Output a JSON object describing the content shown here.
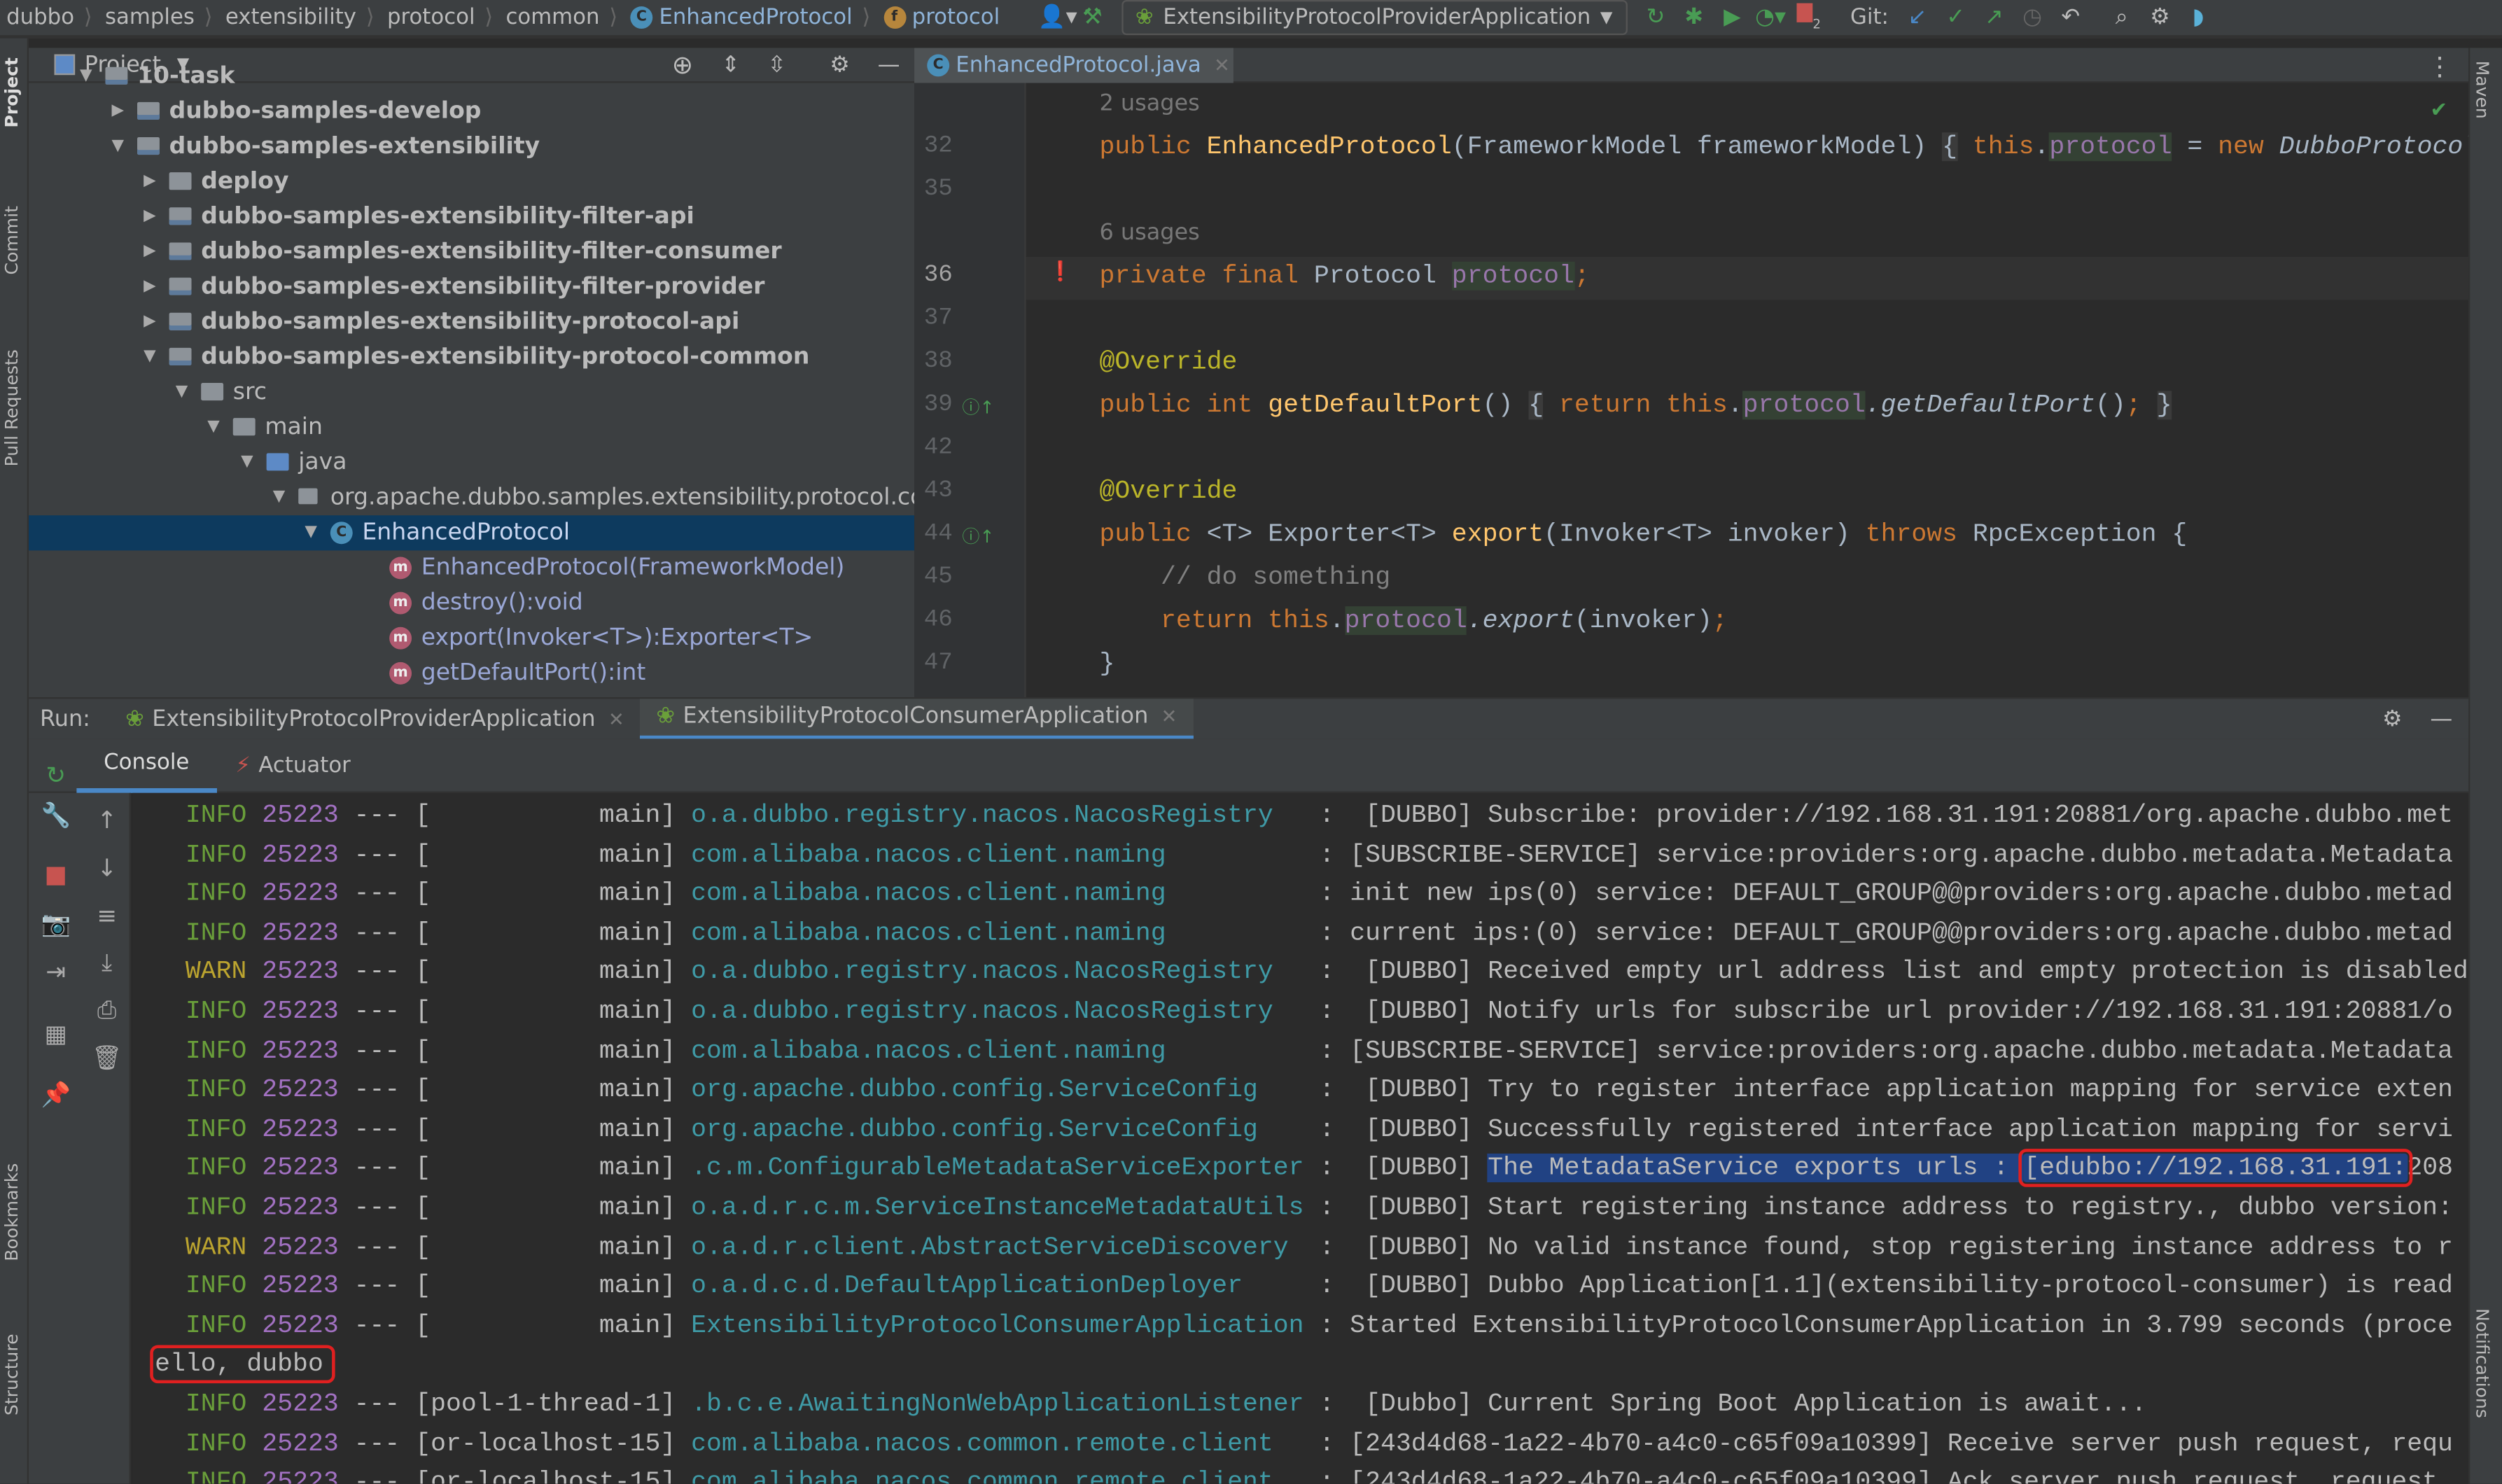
{
  "breadcrumb": [
    "dubbo",
    "samples",
    "extensibility",
    "protocol",
    "common",
    "EnhancedProtocol",
    "protocol"
  ],
  "toolbar": {
    "run_config": "ExtensibilityProtocolProviderApplication",
    "git_label": "Git:",
    "stop_badge": "2",
    "accent": "#499c54"
  },
  "left_strip": {
    "project": "Project",
    "commit": "Commit",
    "pull_requests": "Pull Requests",
    "bookmarks": "Bookmarks",
    "structure": "Structure"
  },
  "right_strip": {
    "maven": "Maven",
    "notifications": "Notifications"
  },
  "project": {
    "title": "Project",
    "tree": [
      {
        "label": "10-task",
        "depth": 0,
        "icon": "module",
        "expanded": true
      },
      {
        "label": "dubbo-samples-develop",
        "depth": 1,
        "icon": "module",
        "expanded": false
      },
      {
        "label": "dubbo-samples-extensibility",
        "depth": 1,
        "icon": "module",
        "expanded": true
      },
      {
        "label": "deploy",
        "depth": 2,
        "icon": "folder",
        "expanded": false
      },
      {
        "label": "dubbo-samples-extensibility-filter-api",
        "depth": 2,
        "icon": "module",
        "expanded": false
      },
      {
        "label": "dubbo-samples-extensibility-filter-consumer",
        "depth": 2,
        "icon": "module",
        "expanded": false
      },
      {
        "label": "dubbo-samples-extensibility-filter-provider",
        "depth": 2,
        "icon": "module",
        "expanded": false
      },
      {
        "label": "dubbo-samples-extensibility-protocol-api",
        "depth": 2,
        "icon": "module",
        "expanded": false
      },
      {
        "label": "dubbo-samples-extensibility-protocol-common",
        "depth": 2,
        "icon": "module",
        "expanded": true
      },
      {
        "label": "src",
        "depth": 3,
        "icon": "folder",
        "expanded": true
      },
      {
        "label": "main",
        "depth": 4,
        "icon": "folder",
        "expanded": true
      },
      {
        "label": "java",
        "depth": 5,
        "icon": "source-folder",
        "expanded": true
      },
      {
        "label": "org.apache.dubbo.samples.extensibility.protocol.common",
        "depth": 6,
        "icon": "package",
        "expanded": true
      },
      {
        "label": "EnhancedProtocol",
        "depth": 7,
        "icon": "class",
        "expanded": true,
        "selected": true
      },
      {
        "label": "EnhancedProtocol(FrameworkModel)",
        "depth": 8,
        "icon": "method"
      },
      {
        "label": "destroy():void",
        "depth": 8,
        "icon": "method"
      },
      {
        "label": "export(Invoker<T>):Exporter<T>",
        "depth": 8,
        "icon": "method"
      },
      {
        "label": "getDefaultPort():int",
        "depth": 8,
        "icon": "method"
      }
    ]
  },
  "editor": {
    "tab": "EnhancedProtocol.java",
    "lines": [
      {
        "num": "",
        "hint": "2 usages"
      },
      {
        "num": "32",
        "tokens": [
          [
            "kw",
            "public "
          ],
          [
            "fn",
            "EnhancedProtocol"
          ],
          [
            "",
            "(FrameworkModel frameworkModel) "
          ],
          [
            "brk",
            "{"
          ],
          [
            "",
            " "
          ],
          [
            "kw",
            "this"
          ],
          [
            "",
            "."
          ],
          [
            "fld hlf",
            "protocol"
          ],
          [
            "",
            " = "
          ],
          [
            "kw",
            "new "
          ],
          [
            "it",
            "DubboProtocol"
          ]
        ]
      },
      {
        "num": "35",
        "tokens": []
      },
      {
        "num": "",
        "hint": "6 usages"
      },
      {
        "num": "36",
        "tokens": [
          [
            "kw",
            "private final "
          ],
          [
            "",
            "Protocol "
          ],
          [
            "fld hlf",
            "protocol"
          ],
          [
            "kw",
            ";"
          ]
        ]
      },
      {
        "num": "37",
        "tokens": []
      },
      {
        "num": "38",
        "tokens": [
          [
            "ann",
            "@Override"
          ]
        ]
      },
      {
        "num": "39",
        "tokens": [
          [
            "kw",
            "public int "
          ],
          [
            "fn",
            "getDefaultPort"
          ],
          [
            "",
            "() "
          ],
          [
            "brk",
            "{"
          ],
          [
            "kw",
            " return this"
          ],
          [
            "",
            "."
          ],
          [
            "fld hlf",
            "protocol"
          ],
          [
            "it",
            ".getDefaultPort"
          ],
          [
            "",
            "()"
          ],
          [
            "kw",
            ";"
          ],
          [
            "",
            " "
          ],
          [
            "brk",
            "}"
          ]
        ]
      },
      {
        "num": "42",
        "tokens": []
      },
      {
        "num": "43",
        "tokens": [
          [
            "ann",
            "@Override"
          ]
        ]
      },
      {
        "num": "44",
        "tokens": [
          [
            "kw",
            "public "
          ],
          [
            "",
            "<T> Exporter<T> "
          ],
          [
            "fn",
            "export"
          ],
          [
            "",
            "(Invoker<T> invoker) "
          ],
          [
            "kw",
            "throws "
          ],
          [
            "",
            "RpcException {"
          ]
        ]
      },
      {
        "num": "45",
        "tokens": [
          [
            "cm",
            "    // do something"
          ]
        ]
      },
      {
        "num": "46",
        "tokens": [
          [
            "kw",
            "    return this"
          ],
          [
            "",
            "."
          ],
          [
            "fld hlf",
            "protocol"
          ],
          [
            "it",
            ".export"
          ],
          [
            "",
            "(invoker)"
          ],
          [
            "kw",
            ";"
          ]
        ]
      },
      {
        "num": "47",
        "tokens": [
          [
            "",
            "}"
          ]
        ]
      }
    ]
  },
  "run": {
    "label": "Run:",
    "tabs": [
      {
        "label": "ExtensibilityProtocolProviderApplication",
        "active": false
      },
      {
        "label": "ExtensibilityProtocolConsumerApplication",
        "active": true
      }
    ],
    "console_tabs": [
      "Console",
      "Actuator"
    ]
  },
  "console": [
    {
      "level": "INFO",
      "pid": "25223",
      "thread": "main",
      "logger": "o.a.dubbo.registry.nacos.NacosRegistry",
      "message": " [DUBBO] Subscribe: provider://192.168.31.191:20881/org.apache.dubbo.met"
    },
    {
      "level": "INFO",
      "pid": "25223",
      "thread": "main",
      "logger": "com.alibaba.nacos.client.naming",
      "message": "[SUBSCRIBE-SERVICE] service:providers:org.apache.dubbo.metadata.Metadata"
    },
    {
      "level": "INFO",
      "pid": "25223",
      "thread": "main",
      "logger": "com.alibaba.nacos.client.naming",
      "message": "init new ips(0) service: DEFAULT_GROUP@@providers:org.apache.dubbo.metad"
    },
    {
      "level": "INFO",
      "pid": "25223",
      "thread": "main",
      "logger": "com.alibaba.nacos.client.naming",
      "message": "current ips:(0) service: DEFAULT_GROUP@@providers:org.apache.dubbo.metad"
    },
    {
      "level": "WARN",
      "pid": "25223",
      "thread": "main",
      "logger": "o.a.dubbo.registry.nacos.NacosRegistry",
      "message": " [DUBBO] Received empty url address list and empty protection is disabled"
    },
    {
      "level": "INFO",
      "pid": "25223",
      "thread": "main",
      "logger": "o.a.dubbo.registry.nacos.NacosRegistry",
      "message": " [DUBBO] Notify urls for subscribe url provider://192.168.31.191:20881/o"
    },
    {
      "level": "INFO",
      "pid": "25223",
      "thread": "main",
      "logger": "com.alibaba.nacos.client.naming",
      "message": "[SUBSCRIBE-SERVICE] service:providers:org.apache.dubbo.metadata.Metadata"
    },
    {
      "level": "INFO",
      "pid": "25223",
      "thread": "main",
      "logger": "org.apache.dubbo.config.ServiceConfig",
      "message": " [DUBBO] Try to register interface application mapping for service exten"
    },
    {
      "level": "INFO",
      "pid": "25223",
      "thread": "main",
      "logger": "org.apache.dubbo.config.ServiceConfig",
      "message": " [DUBBO] Successfully registered interface application mapping for servi"
    },
    {
      "level": "INFO",
      "pid": "25223",
      "thread": "main",
      "logger": ".c.m.ConfigurableMetadataServiceExporter",
      "message": " [DUBBO] ",
      "selected": "The MetadataService exports urls : ",
      "boxed": "[edubbo://192.168.31.191:",
      "rest": "208"
    },
    {
      "level": "INFO",
      "pid": "25223",
      "thread": "main",
      "logger": "o.a.d.r.c.m.ServiceInstanceMetadataUtils",
      "message": " [DUBBO] Start registering instance address to registry., dubbo version:"
    },
    {
      "level": "WARN",
      "pid": "25223",
      "thread": "main",
      "logger": "o.a.d.r.client.AbstractServiceDiscovery",
      "message": " [DUBBO] No valid instance found, stop registering instance address to r"
    },
    {
      "level": "INFO",
      "pid": "25223",
      "thread": "main",
      "logger": "o.a.d.c.d.DefaultApplicationDeployer",
      "message": " [DUBBO] Dubbo Application[1.1](extensibility-protocol-consumer) is read"
    },
    {
      "level": "INFO",
      "pid": "25223",
      "thread": "main",
      "logger": "ExtensibilityProtocolConsumerApplication",
      "message": "Started ExtensibilityProtocolConsumerApplication in 3.799 seconds (proce"
    },
    {
      "plain": "ello, dubbo"
    },
    {
      "level": "INFO",
      "pid": "25223",
      "thread": "pool-1-thread-1",
      "logger": ".b.c.e.AwaitingNonWebApplicationListener",
      "message": " [Dubbo] Current Spring Boot Application is await..."
    },
    {
      "level": "INFO",
      "pid": "25223",
      "thread": "or-localhost-15",
      "logger": "com.alibaba.nacos.common.remote.client",
      "message": "[243d4d68-1a22-4b70-a4c0-c65f09a10399] Receive server push request, requ"
    },
    {
      "level": "INFO",
      "pid": "25223",
      "thread": "or-localhost-15",
      "logger": "com.alibaba.nacos.common.remote.client",
      "message": "[243d4d68-1a22-4b70-a4c0-c65f09a10399] Ack server push request, request"
    }
  ],
  "console_sep": "---"
}
